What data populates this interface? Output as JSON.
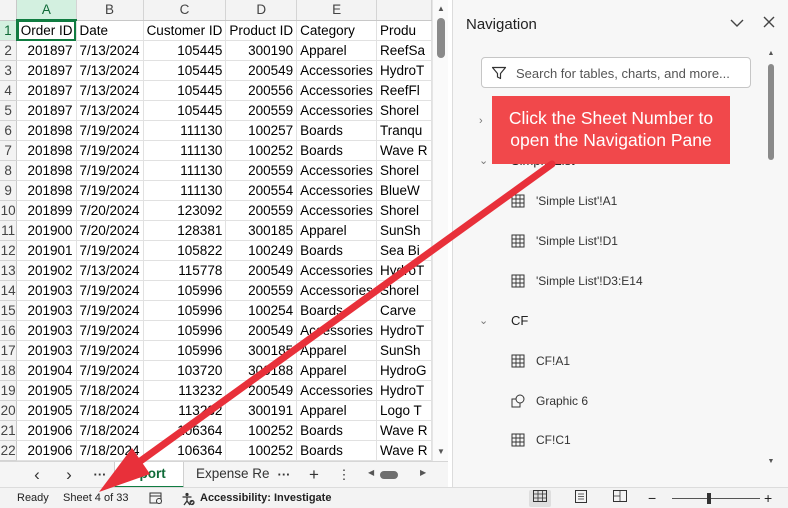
{
  "grid": {
    "columns": [
      "A",
      "B",
      "C",
      "D",
      "E",
      ""
    ],
    "header_row": [
      "Order ID",
      "Date",
      "Customer ID",
      "Product ID",
      "Category",
      "Produ"
    ],
    "rows": [
      {
        "n": "2",
        "cells": [
          "201897",
          "7/13/2024",
          "105445",
          "300190",
          "Apparel",
          "ReefSa"
        ]
      },
      {
        "n": "3",
        "cells": [
          "201897",
          "7/13/2024",
          "105445",
          "200549",
          "Accessories",
          "HydroT"
        ]
      },
      {
        "n": "4",
        "cells": [
          "201897",
          "7/13/2024",
          "105445",
          "200556",
          "Accessories",
          "ReefFl"
        ]
      },
      {
        "n": "5",
        "cells": [
          "201897",
          "7/13/2024",
          "105445",
          "200559",
          "Accessories",
          "Shorel"
        ]
      },
      {
        "n": "6",
        "cells": [
          "201898",
          "7/19/2024",
          "111130",
          "100257",
          "Boards",
          "Tranqu"
        ]
      },
      {
        "n": "7",
        "cells": [
          "201898",
          "7/19/2024",
          "111130",
          "100252",
          "Boards",
          "Wave R"
        ]
      },
      {
        "n": "8",
        "cells": [
          "201898",
          "7/19/2024",
          "111130",
          "200559",
          "Accessories",
          "Shorel"
        ]
      },
      {
        "n": "9",
        "cells": [
          "201898",
          "7/19/2024",
          "111130",
          "200554",
          "Accessories",
          "BlueW"
        ]
      },
      {
        "n": "10",
        "cells": [
          "201899",
          "7/20/2024",
          "123092",
          "200559",
          "Accessories",
          "Shorel"
        ]
      },
      {
        "n": "11",
        "cells": [
          "201900",
          "7/20/2024",
          "128381",
          "300185",
          "Apparel",
          "SunSh"
        ]
      },
      {
        "n": "12",
        "cells": [
          "201901",
          "7/19/2024",
          "105822",
          "100249",
          "Boards",
          "Sea Bi"
        ]
      },
      {
        "n": "13",
        "cells": [
          "201902",
          "7/13/2024",
          "115778",
          "200549",
          "Accessories",
          "HydroT"
        ]
      },
      {
        "n": "14",
        "cells": [
          "201903",
          "7/19/2024",
          "105996",
          "200559",
          "Accessories",
          "Shorel"
        ]
      },
      {
        "n": "15",
        "cells": [
          "201903",
          "7/19/2024",
          "105996",
          "100254",
          "Boards",
          "Carve"
        ]
      },
      {
        "n": "16",
        "cells": [
          "201903",
          "7/19/2024",
          "105996",
          "200549",
          "Accessories",
          "HydroT"
        ]
      },
      {
        "n": "17",
        "cells": [
          "201903",
          "7/19/2024",
          "105996",
          "300185",
          "Apparel",
          "SunSh"
        ]
      },
      {
        "n": "18",
        "cells": [
          "201904",
          "7/19/2024",
          "103720",
          "300188",
          "Apparel",
          "HydroG"
        ]
      },
      {
        "n": "19",
        "cells": [
          "201905",
          "7/18/2024",
          "113232",
          "200549",
          "Accessories",
          "HydroT"
        ]
      },
      {
        "n": "20",
        "cells": [
          "201905",
          "7/18/2024",
          "113232",
          "300191",
          "Apparel",
          "Logo T"
        ]
      },
      {
        "n": "21",
        "cells": [
          "201906",
          "7/18/2024",
          "106364",
          "100252",
          "Boards",
          "Wave R"
        ]
      },
      {
        "n": "22",
        "cells": [
          "201906",
          "7/18/2024",
          "106364",
          "100252",
          "Boards",
          "Wave R"
        ]
      }
    ]
  },
  "tabbar": {
    "prev": "‹",
    "next": "›",
    "more_left": "···",
    "active_sheet": "Export",
    "other_sheet": "Expense Re",
    "more_right": "···",
    "add": "+",
    "options": "⋮"
  },
  "status": {
    "ready": "Ready",
    "sheet": "Sheet 4 of 33",
    "accessibility": "Accessibility: Investigate",
    "zoom_minus": "−",
    "zoom_plus": "+"
  },
  "nav": {
    "title": "Navigation",
    "search_placeholder": "Search for tables, charts, and more...",
    "items": [
      {
        "type": "section",
        "chevron": "›",
        "label": ""
      },
      {
        "type": "section",
        "chevron": "⌄",
        "label": "Simple List"
      },
      {
        "type": "range",
        "icon": "table-icon",
        "label": "'Simple List'!A1"
      },
      {
        "type": "range",
        "icon": "table-icon",
        "label": "'Simple List'!D1"
      },
      {
        "type": "range",
        "icon": "table-icon",
        "label": "'Simple List'!D3:E14"
      },
      {
        "type": "section",
        "chevron": "⌄",
        "label": "CF"
      },
      {
        "type": "range",
        "icon": "table-icon",
        "label": "CF!A1"
      },
      {
        "type": "shape",
        "icon": "shapes-icon",
        "label": "Graphic 6"
      },
      {
        "type": "range",
        "icon": "table-icon",
        "label": "CF!C1"
      }
    ]
  },
  "callout": {
    "line1": "Click the Sheet Number to",
    "line2": "open the Navigation Pane"
  },
  "colors": {
    "excel_green": "#107c41",
    "callout_red": "#f1484b"
  }
}
